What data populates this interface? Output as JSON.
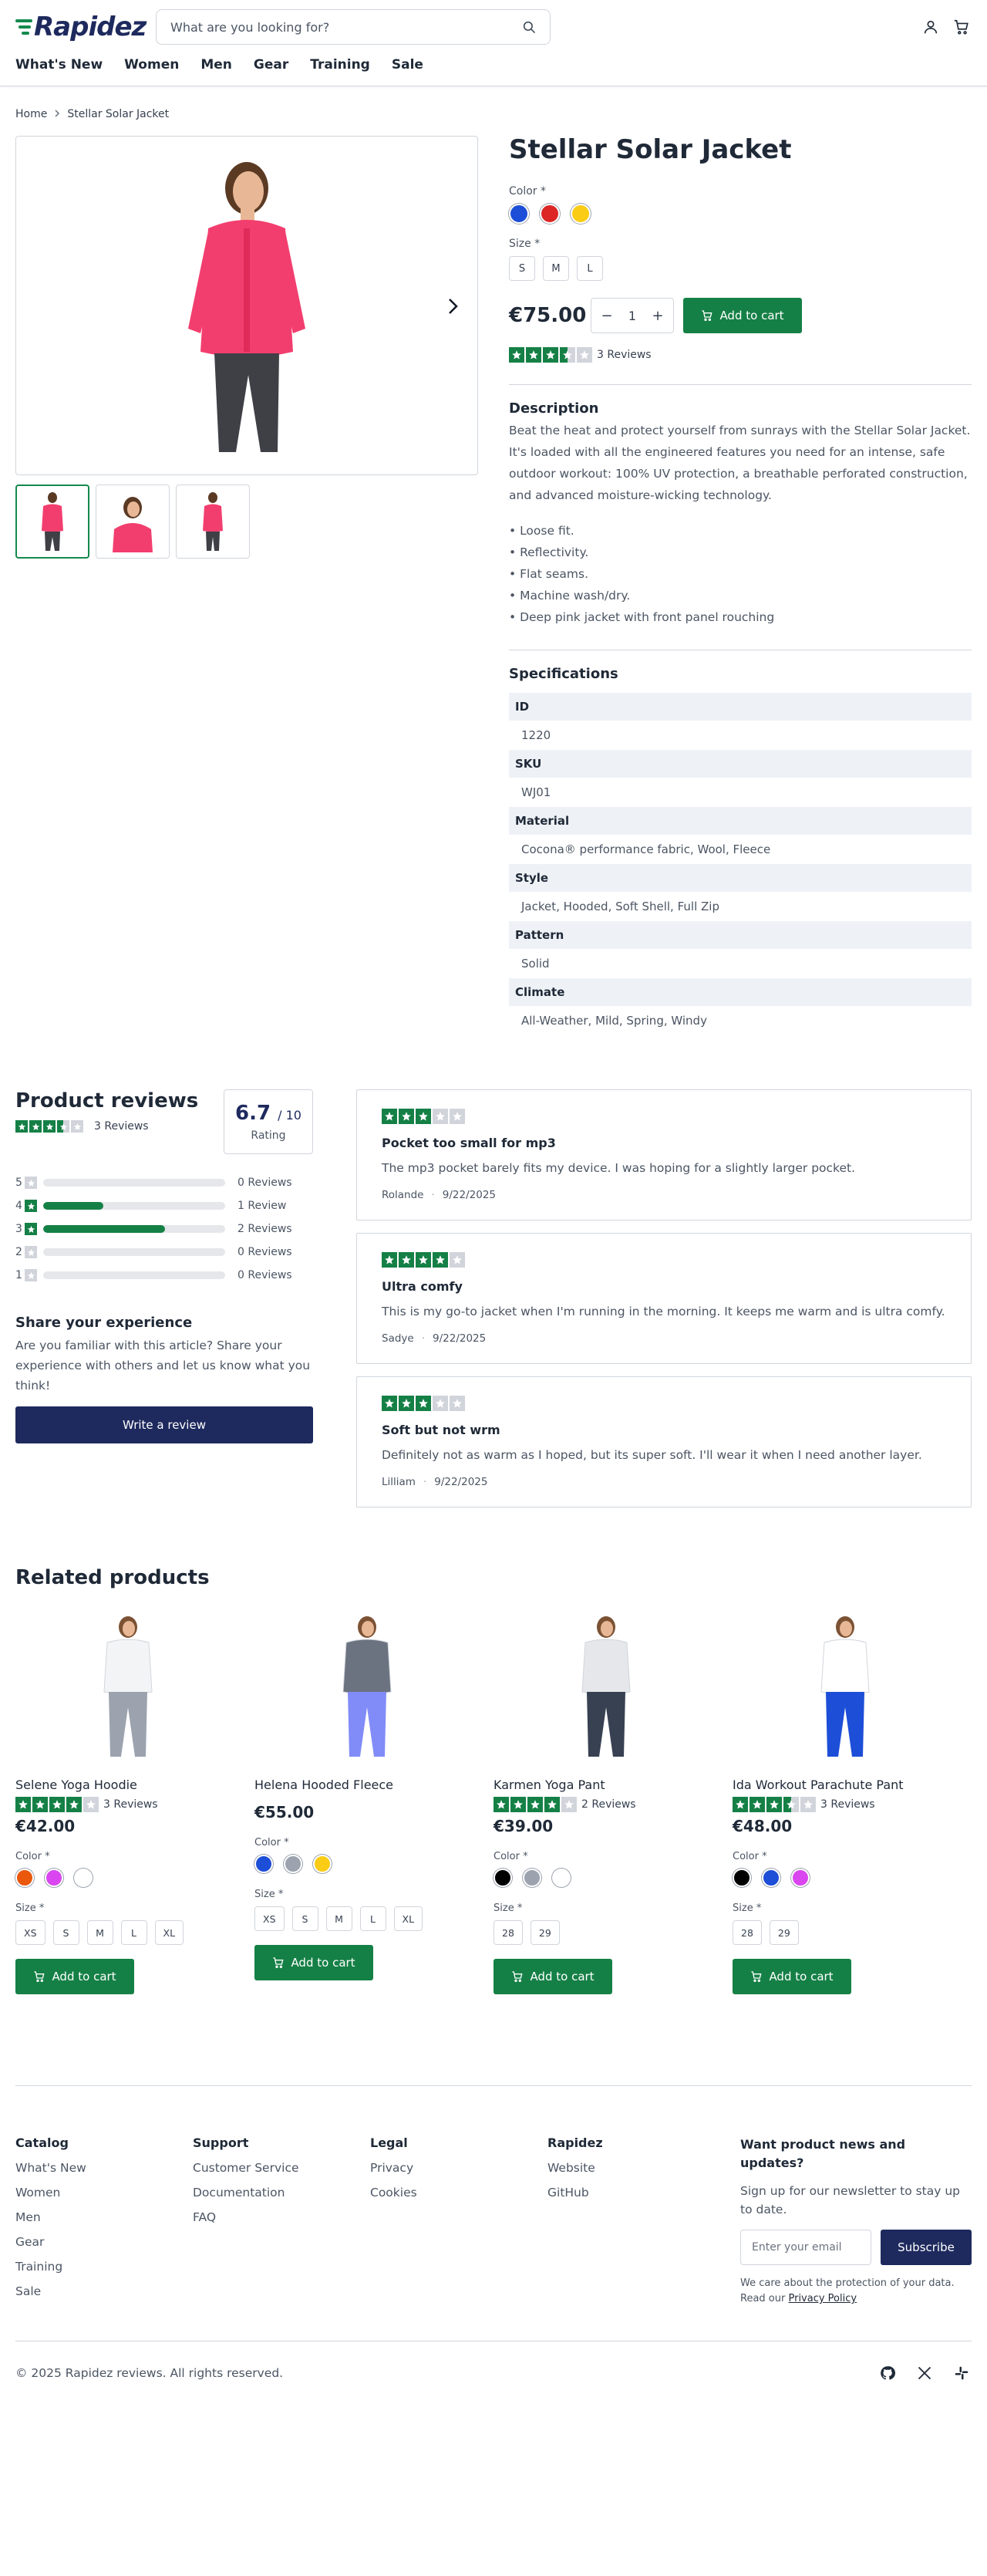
{
  "header": {
    "logo": "Rapidez",
    "search_placeholder": "What are you looking for?"
  },
  "nav": [
    "What's New",
    "Women",
    "Men",
    "Gear",
    "Training",
    "Sale"
  ],
  "breadcrumb": [
    "Home",
    "Stellar Solar Jacket"
  ],
  "product": {
    "title": "Stellar Solar Jacket",
    "color_label": "Color *",
    "colors": [
      "#1d4ed8",
      "#dc2626",
      "#facc15"
    ],
    "size_label": "Size *",
    "sizes": [
      "S",
      "M",
      "L"
    ],
    "price": "€75.00",
    "qty": "1",
    "qty_minus": "−",
    "qty_plus": "+",
    "add_to_cart": "Add to cart",
    "rating": 3.5,
    "reviews_count": "3 Reviews",
    "image_color": "#f23e6e",
    "description_title": "Description",
    "description": "Beat the heat and protect yourself from sunrays with the Stellar Solar Jacket. It's loaded with all the engineered features you need for an intense, safe outdoor workout: 100% UV protection, a breathable perforated construction, and advanced moisture-wicking technology.",
    "bullets": [
      "• Loose fit.",
      "• Reflectivity.",
      "• Flat seams.",
      "• Machine wash/dry.",
      "• Deep pink jacket with front panel rouching"
    ],
    "specs_title": "Specifications",
    "specs": [
      {
        "key": "ID",
        "value": "1220"
      },
      {
        "key": "SKU",
        "value": "WJ01"
      },
      {
        "key": "Material",
        "value": "Cocona® performance fabric, Wool, Fleece"
      },
      {
        "key": "Style",
        "value": "Jacket, Hooded, Soft Shell, Full Zip"
      },
      {
        "key": "Pattern",
        "value": "Solid"
      },
      {
        "key": "Climate",
        "value": "All-Weather, Mild, Spring, Windy"
      }
    ]
  },
  "reviews": {
    "title": "Product reviews",
    "count": "3 Reviews",
    "avg_stars": 3.5,
    "score": "6.7",
    "score_max": "/ 10",
    "score_label": "Rating",
    "breakdown": [
      {
        "stars": "5",
        "fill": 0,
        "label": "0 Reviews"
      },
      {
        "stars": "4",
        "fill": 0.33,
        "label": "1 Review"
      },
      {
        "stars": "3",
        "fill": 0.67,
        "label": "2 Reviews"
      },
      {
        "stars": "2",
        "fill": 0,
        "label": "0 Reviews"
      },
      {
        "stars": "1",
        "fill": 0,
        "label": "0 Reviews"
      }
    ],
    "share_title": "Share your experience",
    "share_text": "Are you familiar with this article? Share your experience with others and let us know what you think!",
    "write_button": "Write a review",
    "items": [
      {
        "stars": 3,
        "title": "Pocket too small for mp3",
        "body": "The mp3 pocket barely fits my device. I was hoping for a slightly larger pocket.",
        "author": "Rolande",
        "dot": "·",
        "date": "9/22/2025"
      },
      {
        "stars": 4,
        "title": "Ultra comfy",
        "body": "This is my go-to jacket when I'm running in the morning. It keeps me warm and is ultra comfy.",
        "author": "Sadye",
        "dot": "·",
        "date": "9/22/2025"
      },
      {
        "stars": 3,
        "title": "Soft but not wrm",
        "body": "Definitely not as warm as I hoped, but its super soft. I'll wear it when I need another layer.",
        "author": "Lilliam",
        "dot": "·",
        "date": "9/22/2025"
      }
    ]
  },
  "related": {
    "title": "Related products",
    "color_label": "Color *",
    "size_label": "Size *",
    "add_to_cart": "Add to cart",
    "items": [
      {
        "name": "Selene Yoga Hoodie",
        "rating": 4,
        "reviews": "3 Reviews",
        "price": "€42.00",
        "colors": [
          "#ea580c",
          "#d946ef",
          "#ffffff"
        ],
        "sizes": [
          "XS",
          "S",
          "M",
          "L",
          "XL"
        ],
        "top": "#f3f4f6",
        "bottom": "#9ca3af"
      },
      {
        "name": "Helena Hooded Fleece",
        "rating": 0,
        "reviews": "",
        "price": "€55.00",
        "colors": [
          "#1d4ed8",
          "#9ca3af",
          "#facc15"
        ],
        "sizes": [
          "XS",
          "S",
          "M",
          "L",
          "XL"
        ],
        "top": "#6b7280",
        "bottom": "#818cf8"
      },
      {
        "name": "Karmen Yoga Pant",
        "rating": 4,
        "reviews": "2 Reviews",
        "price": "€39.00",
        "colors": [
          "#000000",
          "#9ca3af",
          "#ffffff"
        ],
        "sizes": [
          "28",
          "29"
        ],
        "top": "#e5e7eb",
        "bottom": "#374151"
      },
      {
        "name": "Ida Workout Parachute Pant",
        "rating": 3.5,
        "reviews": "3 Reviews",
        "price": "€48.00",
        "colors": [
          "#000000",
          "#1d4ed8",
          "#d946ef"
        ],
        "sizes": [
          "28",
          "29"
        ],
        "top": "#ffffff",
        "bottom": "#1d4ed8"
      }
    ]
  },
  "footer": {
    "columns": [
      {
        "title": "Catalog",
        "links": [
          "What's New",
          "Women",
          "Men",
          "Gear",
          "Training",
          "Sale"
        ]
      },
      {
        "title": "Support",
        "links": [
          "Customer Service",
          "Documentation",
          "FAQ"
        ]
      },
      {
        "title": "Legal",
        "links": [
          "Privacy",
          "Cookies"
        ]
      },
      {
        "title": "Rapidez",
        "links": [
          "Website",
          "GitHub"
        ]
      }
    ],
    "newsletter_title": "Want product news and updates?",
    "newsletter_text": "Sign up for our newsletter to stay up to date.",
    "email_placeholder": "Enter your email",
    "subscribe": "Subscribe",
    "fine_print": "We care about the protection of your data. Read our",
    "privacy_link": "Privacy Policy",
    "copyright": "© 2025 Rapidez reviews. All rights reserved.",
    "socials": [
      "github-icon",
      "x-icon",
      "slack-icon"
    ]
  }
}
